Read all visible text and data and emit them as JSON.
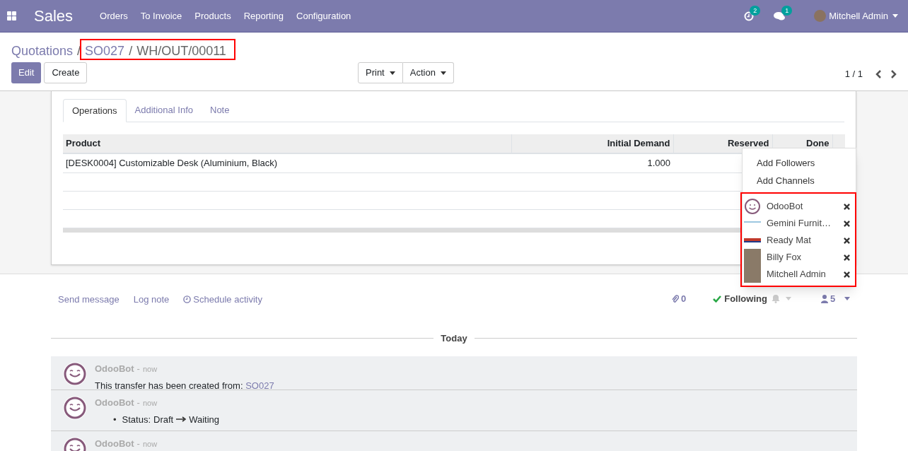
{
  "app": {
    "name": "Sales",
    "menu": [
      "Orders",
      "To Invoice",
      "Products",
      "Reporting",
      "Configuration"
    ]
  },
  "systray": {
    "activities_count": "2",
    "messages_count": "1",
    "user": "Mitchell Admin"
  },
  "breadcrumb": [
    {
      "label": "Quotations",
      "link": true
    },
    {
      "separator": "/",
      "label": "SO027",
      "link": true
    },
    {
      "separator": "/",
      "label": "WH/OUT/00011",
      "link": false
    }
  ],
  "annotations": {
    "breadcrumb_highlighted": true,
    "followers_highlighted": true
  },
  "buttons": [
    {
      "label": "Edit",
      "primary": true
    },
    {
      "label": "Create",
      "primary": false
    }
  ],
  "dropdowns": [
    "Print",
    "Action"
  ],
  "pager": "1 / 1",
  "tabs": [
    {
      "label": "Operations",
      "selected": true
    },
    {
      "label": "Additional Info",
      "selected": false
    },
    {
      "label": "Note",
      "selected": false
    }
  ],
  "table": {
    "columns": [
      "Product",
      "Initial Demand",
      "Reserved",
      "Done"
    ],
    "rows": [
      [
        "[DESK0004] Customizable Desk (Aluminium, Black)",
        "1.000"
      ]
    ]
  },
  "followers_menu": {
    "actions": [
      "Add Followers",
      "Add Channels"
    ],
    "followers": [
      {
        "name": "OdooBot",
        "kind": "bot"
      },
      {
        "name": "Gemini Furnit…",
        "kind": "logo"
      },
      {
        "name": "Ready Mat",
        "kind": "badge"
      },
      {
        "name": "Billy Fox",
        "kind": "person"
      },
      {
        "name": "Mitchell Admin",
        "kind": "person"
      }
    ]
  },
  "chatter": {
    "actions": [
      "Send message",
      "Log note",
      "Schedule activity"
    ],
    "attachments": "0",
    "follow": "Following",
    "followers_count": "5",
    "divider": "Today",
    "messages": [
      {
        "author": "OdooBot",
        "dash": "-",
        "time": "now",
        "kind": "text",
        "text": "This transfer has been created from: ",
        "link": "SO027"
      },
      {
        "author": "OdooBot",
        "dash": "-",
        "time": "now",
        "kind": "tracking",
        "bullet": "•",
        "field": "Status:",
        "old": "Draft",
        "new": "Waiting"
      },
      {
        "author": "OdooBot",
        "dash": "-",
        "time": "now",
        "kind": "empty"
      }
    ]
  }
}
